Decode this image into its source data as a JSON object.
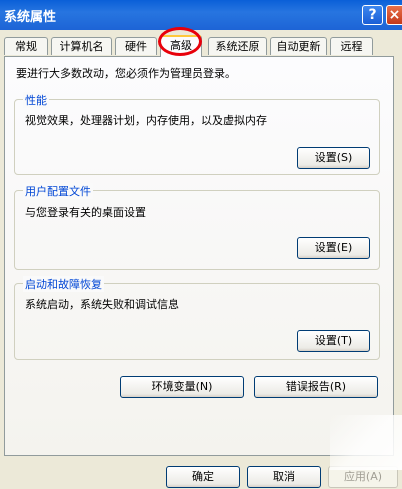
{
  "window": {
    "title": "系统属性",
    "help_label": "?",
    "close_label": "×"
  },
  "tabs": [
    "常规",
    "计算机名",
    "硬件",
    "高级",
    "系统还原",
    "自动更新",
    "远程"
  ],
  "notice": "要进行大多数改动，您必须作为管理员登录。",
  "performance": {
    "title": "性能",
    "description": "视觉效果，处理器计划，内存使用，以及虚拟内存",
    "button": "设置(S)"
  },
  "user_profiles": {
    "title": "用户配置文件",
    "description": "与您登录有关的桌面设置",
    "button": "设置(E)"
  },
  "startup_recovery": {
    "title": "启动和故障恢复",
    "description": "系统启动，系统失败和调试信息",
    "button": "设置(T)"
  },
  "env_button": "环境变量(N)",
  "error_report_button": "错误报告(R)",
  "footer": {
    "ok": "确定",
    "cancel": "取消",
    "apply": "应用(A)"
  }
}
